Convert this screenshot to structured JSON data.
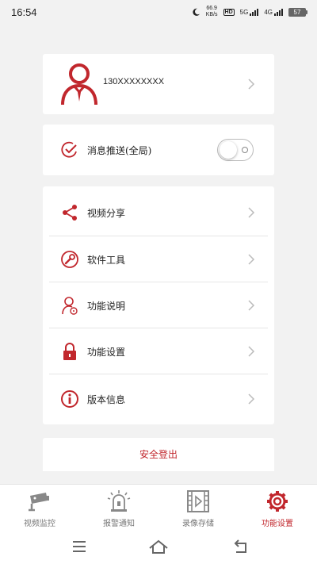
{
  "status_bar": {
    "time": "16:54",
    "net_speed_value": "66.9",
    "net_speed_unit": "KB/s",
    "hd_label": "HD",
    "signal1_label": "5G",
    "signal2_label": "4G",
    "battery": "57"
  },
  "account": {
    "phone": "130XXXXXXXX"
  },
  "push": {
    "label": "消息推送(全局)",
    "enabled": false
  },
  "menu": {
    "items": [
      {
        "label": "视频分享",
        "icon": "share-icon"
      },
      {
        "label": "软件工具",
        "icon": "wrench-icon"
      },
      {
        "label": "功能说明",
        "icon": "person-help-icon"
      },
      {
        "label": "功能设置",
        "icon": "lock-icon"
      },
      {
        "label": "版本信息",
        "icon": "info-icon"
      }
    ]
  },
  "logout": {
    "label": "安全登出"
  },
  "tabs": [
    {
      "label": "视频监控",
      "icon": "camera-icon",
      "active": false
    },
    {
      "label": "报警通知",
      "icon": "alarm-icon",
      "active": false
    },
    {
      "label": "录像存储",
      "icon": "video-file-icon",
      "active": false
    },
    {
      "label": "功能设置",
      "icon": "gear-icon",
      "active": true
    }
  ],
  "colors": {
    "accent": "#c1272d",
    "inactive": "#777777",
    "background": "#f2f2f2"
  }
}
